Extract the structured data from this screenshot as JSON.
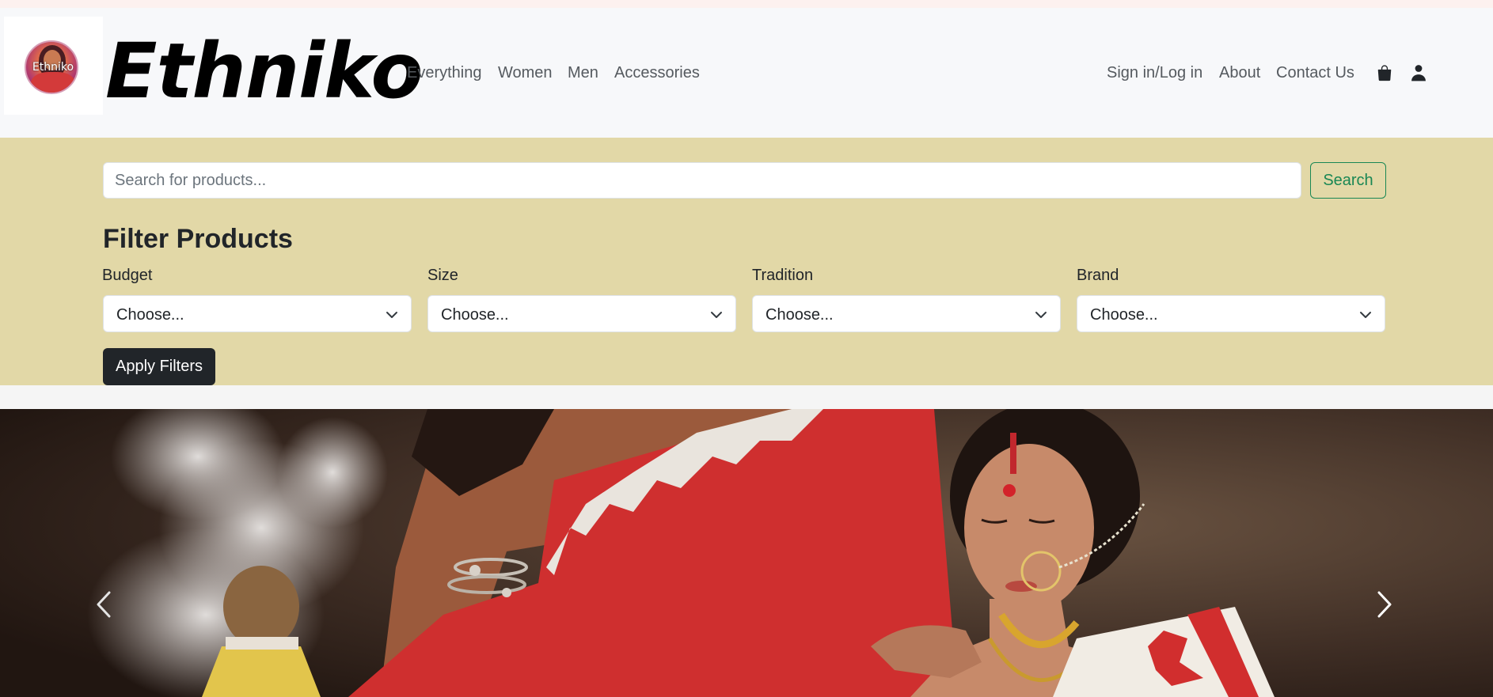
{
  "brand": {
    "logo_text": "Ethniko",
    "name": "Ethniko"
  },
  "nav": {
    "left": [
      "Everything",
      "Women",
      "Men",
      "Accessories"
    ],
    "right": [
      "Sign in/Log in",
      "About",
      "Contact Us"
    ],
    "icons": [
      "shopping-bag-icon",
      "user-icon"
    ]
  },
  "search": {
    "placeholder": "Search for products...",
    "value": "",
    "button_label": "Search"
  },
  "filters": {
    "title": "Filter Products",
    "fields": [
      {
        "label": "Budget",
        "selected": "Choose..."
      },
      {
        "label": "Size",
        "selected": "Choose..."
      },
      {
        "label": "Tradition",
        "selected": "Choose..."
      },
      {
        "label": "Brand",
        "selected": "Choose..."
      }
    ],
    "apply_label": "Apply Filters"
  },
  "carousel": {
    "controls": [
      "chevron-left-icon",
      "chevron-right-icon"
    ]
  },
  "colors": {
    "navbar_bg": "#f7f8fa",
    "filter_bg": "#e2d8a7",
    "search_button": "#198754",
    "apply_button": "#212529",
    "saree_red": "#cf2f2f"
  }
}
